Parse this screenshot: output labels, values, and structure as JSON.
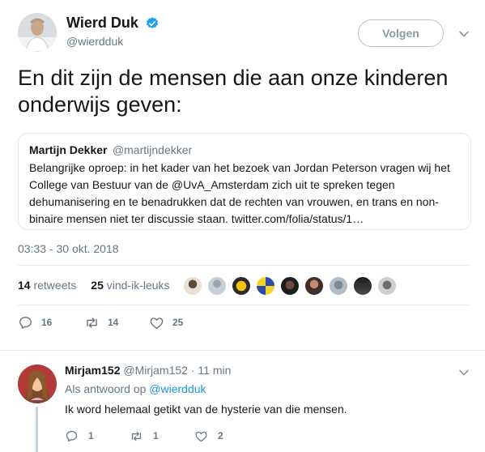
{
  "author": {
    "display_name": "Wierd Duk",
    "handle": "@wierdduk",
    "verified": true
  },
  "follow_button_label": "Volgen",
  "tweet_text": "En dit zijn de mensen die aan onze kinderen onderwijs geven:",
  "quoted_tweet": {
    "display_name": "Martijn Dekker",
    "handle": "@martijndekker",
    "text": "Belangrijke oproep: in het kader van het bezoek van Jordan Peterson vragen wij het College van Bestuur van de @UvA_Amsterdam zich uit te spreken tegen dehumanisering en te benadrukken dat de rechten van vrouwen, en trans en non-binaire mensen niet ter discussie staan. twitter.com/folia/status/1…"
  },
  "timestamp": "03:33 - 30 okt. 2018",
  "stats": {
    "retweets_count": "14",
    "retweets_label": "retweets",
    "likes_count": "25",
    "likes_label": "vind-ik-leuks"
  },
  "likers": [
    "liker-1",
    "liker-2",
    "liker-3",
    "liker-4",
    "liker-5",
    "liker-6",
    "liker-7",
    "liker-8",
    "liker-9"
  ],
  "actions": {
    "reply_count": "16",
    "retweet_count": "14",
    "like_count": "25"
  },
  "reply": {
    "display_name": "Mirjam152",
    "handle": "@Mirjam152",
    "time": "· 11 min",
    "replying_to_label": "Als antwoord op",
    "replying_to_handle": "@wierdduk",
    "text": "Ik word helemaal getikt van de hysterie van die mensen.",
    "reply_count": "1",
    "retweet_count": "1",
    "like_count": "2"
  },
  "colors": {
    "accent": "#1da1f2",
    "secondary_text": "#657786",
    "link": "#1b95e0"
  }
}
